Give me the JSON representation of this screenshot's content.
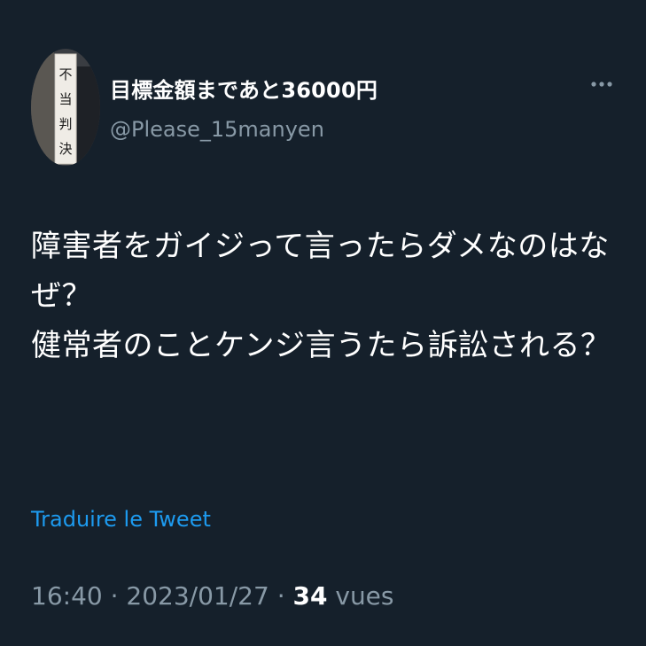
{
  "user": {
    "display_name": "目標金額まであと36000円",
    "handle": "@Please_15manyen",
    "avatar_sign_chars": [
      "不",
      "当",
      "判",
      "決"
    ]
  },
  "menu": {
    "icon": "more-horizontal-icon"
  },
  "tweet": {
    "lines": [
      "障害者をガイジって言ったらダメなのはな",
      "ぜ？",
      "健常者のことケンジ言うたら訴訟される？"
    ]
  },
  "translate_label": "Traduire le Tweet",
  "meta": {
    "time": "16:40",
    "separator1": " · ",
    "date": "2023/01/27",
    "separator2": " · ",
    "views_count": "34",
    "views_label": " vues"
  },
  "colors": {
    "background": "#15202b",
    "secondary_text": "#8899a6",
    "link": "#1d9bf0"
  }
}
